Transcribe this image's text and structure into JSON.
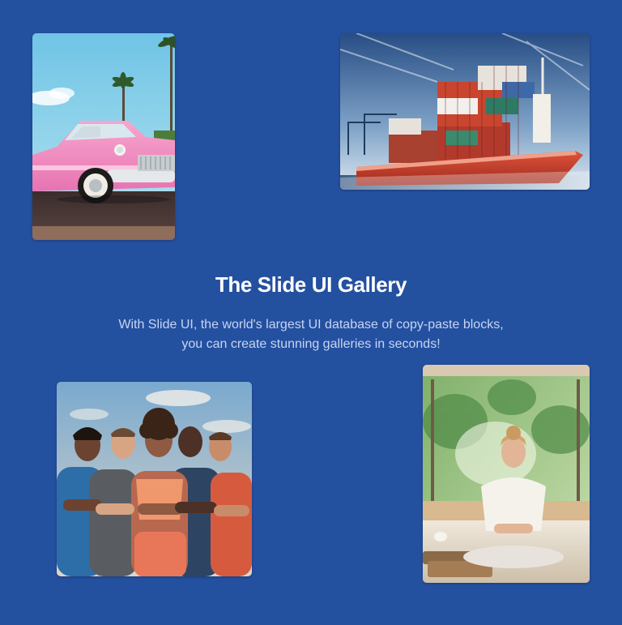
{
  "theme": {
    "background": "#2450a0",
    "title_color": "#ffffff",
    "subtitle_color": "#c7d5f2"
  },
  "gallery": {
    "title": "The Slide UI Gallery",
    "description_line1": "With Slide UI, the world's largest UI database of copy-paste blocks,",
    "description_line2": "you can create stunning galleries in seconds!",
    "images": [
      {
        "name": "pink-vintage-car-photo"
      },
      {
        "name": "cargo-ship-photo"
      },
      {
        "name": "athletes-group-photo"
      },
      {
        "name": "yoga-woman-photo"
      }
    ]
  }
}
